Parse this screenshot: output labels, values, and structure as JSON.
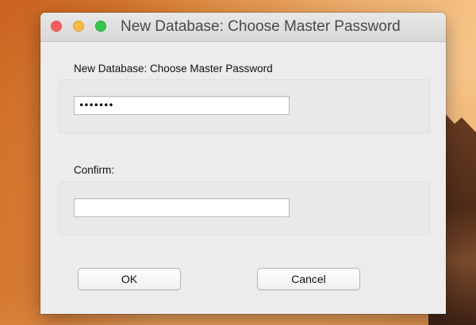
{
  "window": {
    "title": "New Database: Choose Master Password"
  },
  "form": {
    "password_label": "New Database: Choose Master Password",
    "password_value": "•••••••",
    "confirm_label": "Confirm:",
    "confirm_value": ""
  },
  "buttons": {
    "ok_label": "OK",
    "cancel_label": "Cancel"
  },
  "colors": {
    "close": "#fc605c",
    "minimize": "#fdbc40",
    "zoom": "#34c84a"
  }
}
